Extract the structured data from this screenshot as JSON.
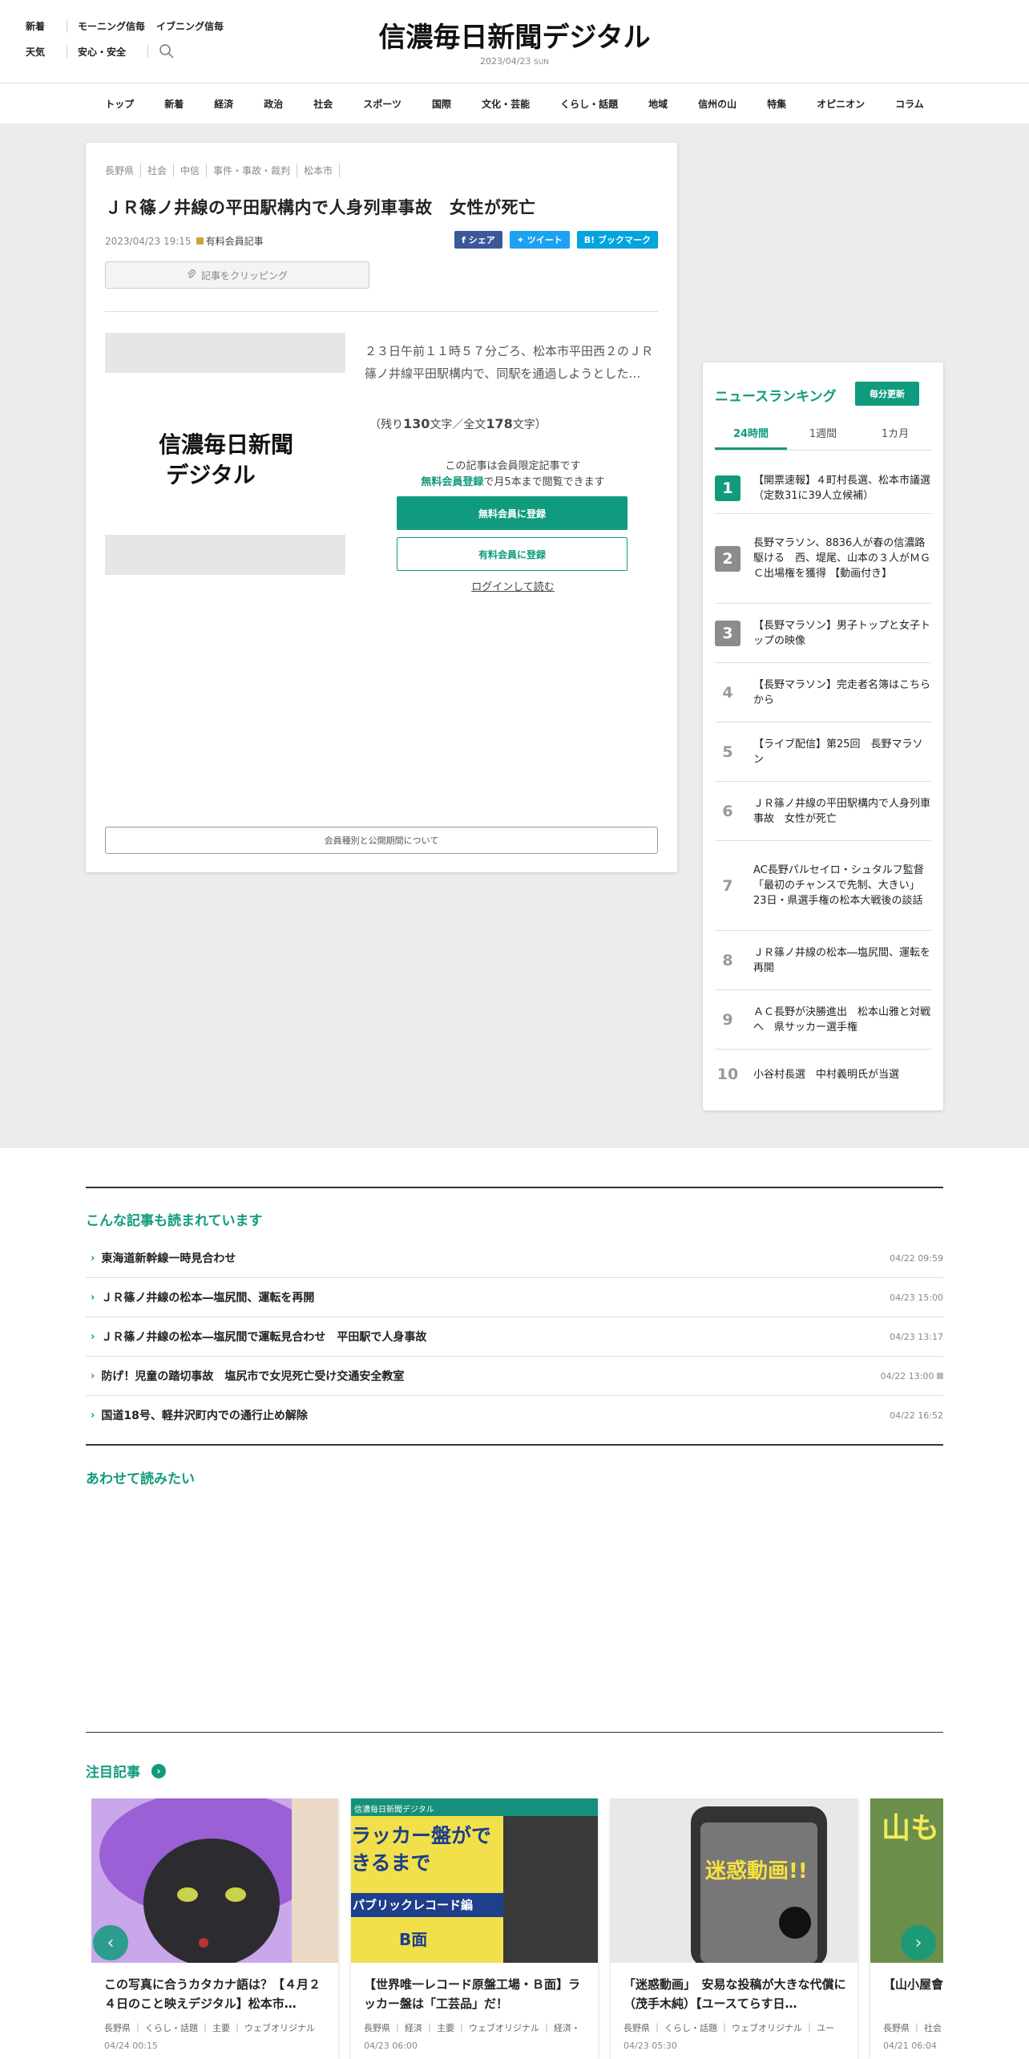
{
  "header": {
    "links_row1": [
      "新着",
      "モーニング信毎",
      "イブニング信毎"
    ],
    "links_row2": [
      "天気",
      "安心・安全"
    ],
    "logo": "信濃毎日新聞デジタル",
    "date": "2023/04/23",
    "weekday": "SUN"
  },
  "nav": [
    "トップ",
    "新着",
    "経済",
    "政治",
    "社会",
    "スポーツ",
    "国際",
    "文化・芸能",
    "くらし・話題",
    "地域",
    "信州の山",
    "特集",
    "オピニオン",
    "コラム"
  ],
  "article": {
    "tags": [
      "長野県",
      "社会",
      "中信",
      "事件・事故・裁判",
      "松本市"
    ],
    "title": "ＪＲ篠ノ井線の平田駅構内で人身列車事故　女性が死亡",
    "date": "2023/04/23 19:15",
    "paid_label": "有料会員記事",
    "share": [
      "シェア",
      "ツイート",
      "ブックマーク"
    ],
    "share_colors": [
      "#3b5998",
      "#1da1f2",
      "#00a4de"
    ],
    "clip_label": "記事をクリッピング",
    "image_logo": "信濃毎日新聞デジタル",
    "lead": "２３日午前１１時５７分ごろ、松本市平田西２のＪＲ篠ノ井線平田駅構内で、同駅を通過しようとした…",
    "remain_prefix": "（残り",
    "remain_chars": "130",
    "remain_mid": "文字／全文",
    "total_chars": "178",
    "remain_suffix": "文字）",
    "limited_line1": "この記事は会員限定記事です",
    "limited_free_link": "無料会員登録",
    "limited_line2_rest": "で月5本まで閲覧できます",
    "btn_free": "無料会員に登録",
    "btn_paid": "有料会員に登録",
    "login": "ログインして読む",
    "membership": "会員種別と公開期間について"
  },
  "ranking": {
    "title": "ニュースランキング",
    "badge": "毎分更新",
    "tabs": [
      "24時間",
      "1週間",
      "1カ月"
    ],
    "items": [
      {
        "rank": "1",
        "text": "【開票速報】４町村長選、松本市議選（定数31に39人立候補）"
      },
      {
        "rank": "2",
        "text": "長野マラソン、8836人が春の信濃路駆ける　西、堤尾、山本の３人がＭＧＣ出場権を獲得 【動画付き】"
      },
      {
        "rank": "3",
        "text": "【長野マラソン】男子トップと女子トップの映像"
      },
      {
        "rank": "4",
        "text": "【長野マラソン】完走者名簿はこちらから"
      },
      {
        "rank": "5",
        "text": "【ライブ配信】第25回　長野マラソン"
      },
      {
        "rank": "6",
        "text": "ＪＲ篠ノ井線の平田駅構内で人身列車事故　女性が死亡"
      },
      {
        "rank": "7",
        "text": "AC長野パルセイロ・シュタルフ監督「最初のチャンスで先制、大きい」　23日・県選手権の松本大戦後の談話"
      },
      {
        "rank": "8",
        "text": "ＪＲ篠ノ井線の松本―塩尻間、運転を再開"
      },
      {
        "rank": "9",
        "text": "ＡＣ長野が決勝進出　松本山雅と対戦へ　県サッカー選手権"
      },
      {
        "rank": "10",
        "text": "小谷村長選　中村義明氏が当選"
      }
    ]
  },
  "related": {
    "title": "こんな記事も読まれています",
    "items": [
      {
        "text": "東海道新幹線一時見合わせ",
        "date": "04/22 09:59"
      },
      {
        "text": "ＪＲ篠ノ井線の松本―塩尻間、運転を再開",
        "date": "04/23 15:00"
      },
      {
        "text": "ＪＲ篠ノ井線の松本―塩尻間で運転見合わせ　平田駅で人身事故",
        "date": "04/23 13:17"
      },
      {
        "text": "防げ！児童の踏切事故　塩尻市で女児死亡受け交通安全教室",
        "date": "04/22 13:00"
      },
      {
        "text": "国道18号、軽井沢町内での通行止め解除",
        "date": "04/22 16:52"
      }
    ]
  },
  "also_read": {
    "title": "あわせて読みたい"
  },
  "featured": {
    "title": "注目記事",
    "cards": [
      {
        "title": "この写真に合うカタカナ語は？【４月２４日のこと映えデジタル】松本市…",
        "tags": "長野県 ｜ くらし・話題 ｜ 主要 ｜ ウェブオリジナル",
        "date": "04/24 00:15",
        "pic_text": ""
      },
      {
        "title": "【世界唯一レコード原盤工場・Ｂ面】ラッカー盤は「工芸品」だ！",
        "tags": "長野県 ｜ 経済 ｜ 主要 ｜ ウェブオリジナル ｜ 経済・",
        "date": "04/23 06:00",
        "pic_text": "ラッカー盤ができるまで",
        "pic_sub": "パブリックレコード編",
        "pic_b": "B面",
        "pic_brand": "信濃毎日新聞デジタル"
      },
      {
        "title": "「迷惑動画」　安易な投稿が大きな代償に（茂手木純）【ユースてらす日…",
        "tags": "長野県 ｜ くらし・話題 ｜ ウェブオリジナル ｜ ユー",
        "date": "04/23 05:30",
        "pic_text": "迷惑動画!!"
      },
      {
        "title": "【山小屋會全てがそろ",
        "tags": "長野県 ｜ 社会",
        "date": "04/21 06:04",
        "pic_text": "山も"
      }
    ]
  }
}
